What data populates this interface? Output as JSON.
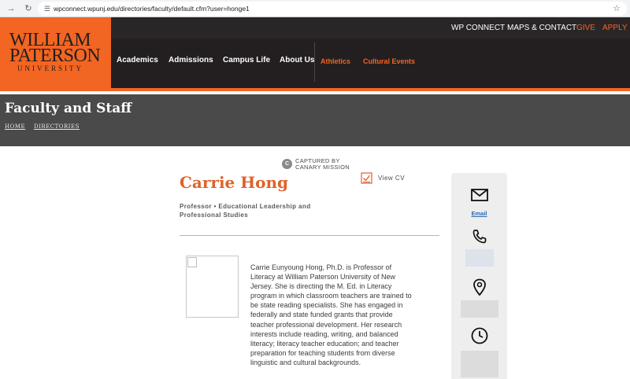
{
  "browser": {
    "url": "wpconnect.wpunj.edu/directories/faculty/default.cfm?user=honge1"
  },
  "header": {
    "logo": {
      "line1": "WILLIAM",
      "line2": "PATERSON",
      "line3": "UNIVERSITY"
    },
    "utility_links": [
      "WP CONNECT",
      "MAPS & CONTACT",
      "GIVE",
      "APPLY"
    ],
    "main_nav": [
      "Academics",
      "Admissions",
      "Campus Life",
      "About Us"
    ],
    "secondary_nav": [
      "Athletics",
      "Cultural Events"
    ],
    "accent_color": "#f26522"
  },
  "banner": {
    "title": "Faculty and Staff",
    "breadcrumb": [
      "HOME",
      "DIRECTORIES"
    ]
  },
  "captured_badge": {
    "line1": "CAPTURED BY",
    "line2": "CANARY MISSION"
  },
  "profile": {
    "name": "Carrie Hong",
    "view_cv_label": "View CV",
    "role_line1": "Professor • Educational Leadership and",
    "role_line2": "Professional Studies",
    "bio": "Carrie Eunyoung Hong, Ph.D. is Professor of Literacy at William Paterson University of New Jersey. She is directing the M. Ed. in Literacy program in which classroom teachers are trained to be state reading specialists. She has engaged in federally and state funded grants that provide teacher professional development. Her research interests include reading, writing, and balanced literacy; literacy teacher education; and teacher preparation for teaching students from diverse linguistic and cultural backgrounds."
  },
  "contact": {
    "email_label": "Email",
    "icons": [
      "envelope-icon",
      "phone-icon",
      "map-pin-icon",
      "clock-icon"
    ]
  }
}
